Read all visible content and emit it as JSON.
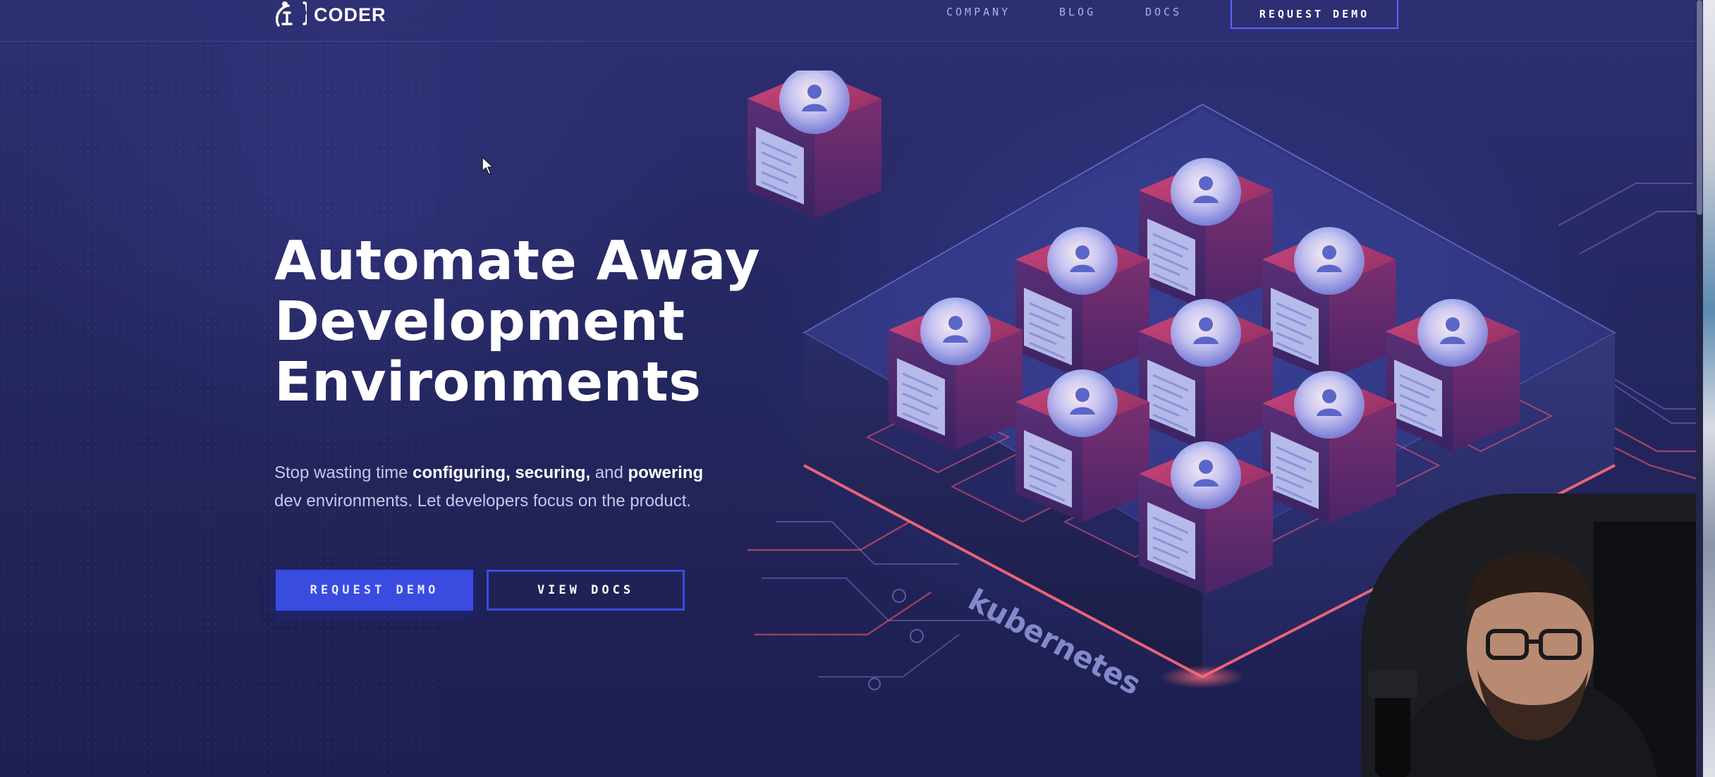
{
  "nav": {
    "logo_text": "CODER",
    "links": [
      "COMPANY",
      "BLOG",
      "DOCS"
    ],
    "cta": "REQUEST DEMO"
  },
  "hero": {
    "title_lines": [
      "Automate Away",
      "Development",
      "Environments"
    ],
    "subtitle": {
      "t1": "Stop wasting time ",
      "b1": "configuring, securing,",
      "t2": " and ",
      "b2": "powering",
      "t3": "dev environments. Let developers focus on the product."
    },
    "primary_button": "REQUEST DEMO",
    "secondary_button": "VIEW DOCS"
  },
  "illustration": {
    "platform_label": "kubernetes",
    "node_count": 10
  },
  "colors": {
    "accent": "#3a4be0",
    "background": "#24265f",
    "node_top": "#c23a6a"
  }
}
